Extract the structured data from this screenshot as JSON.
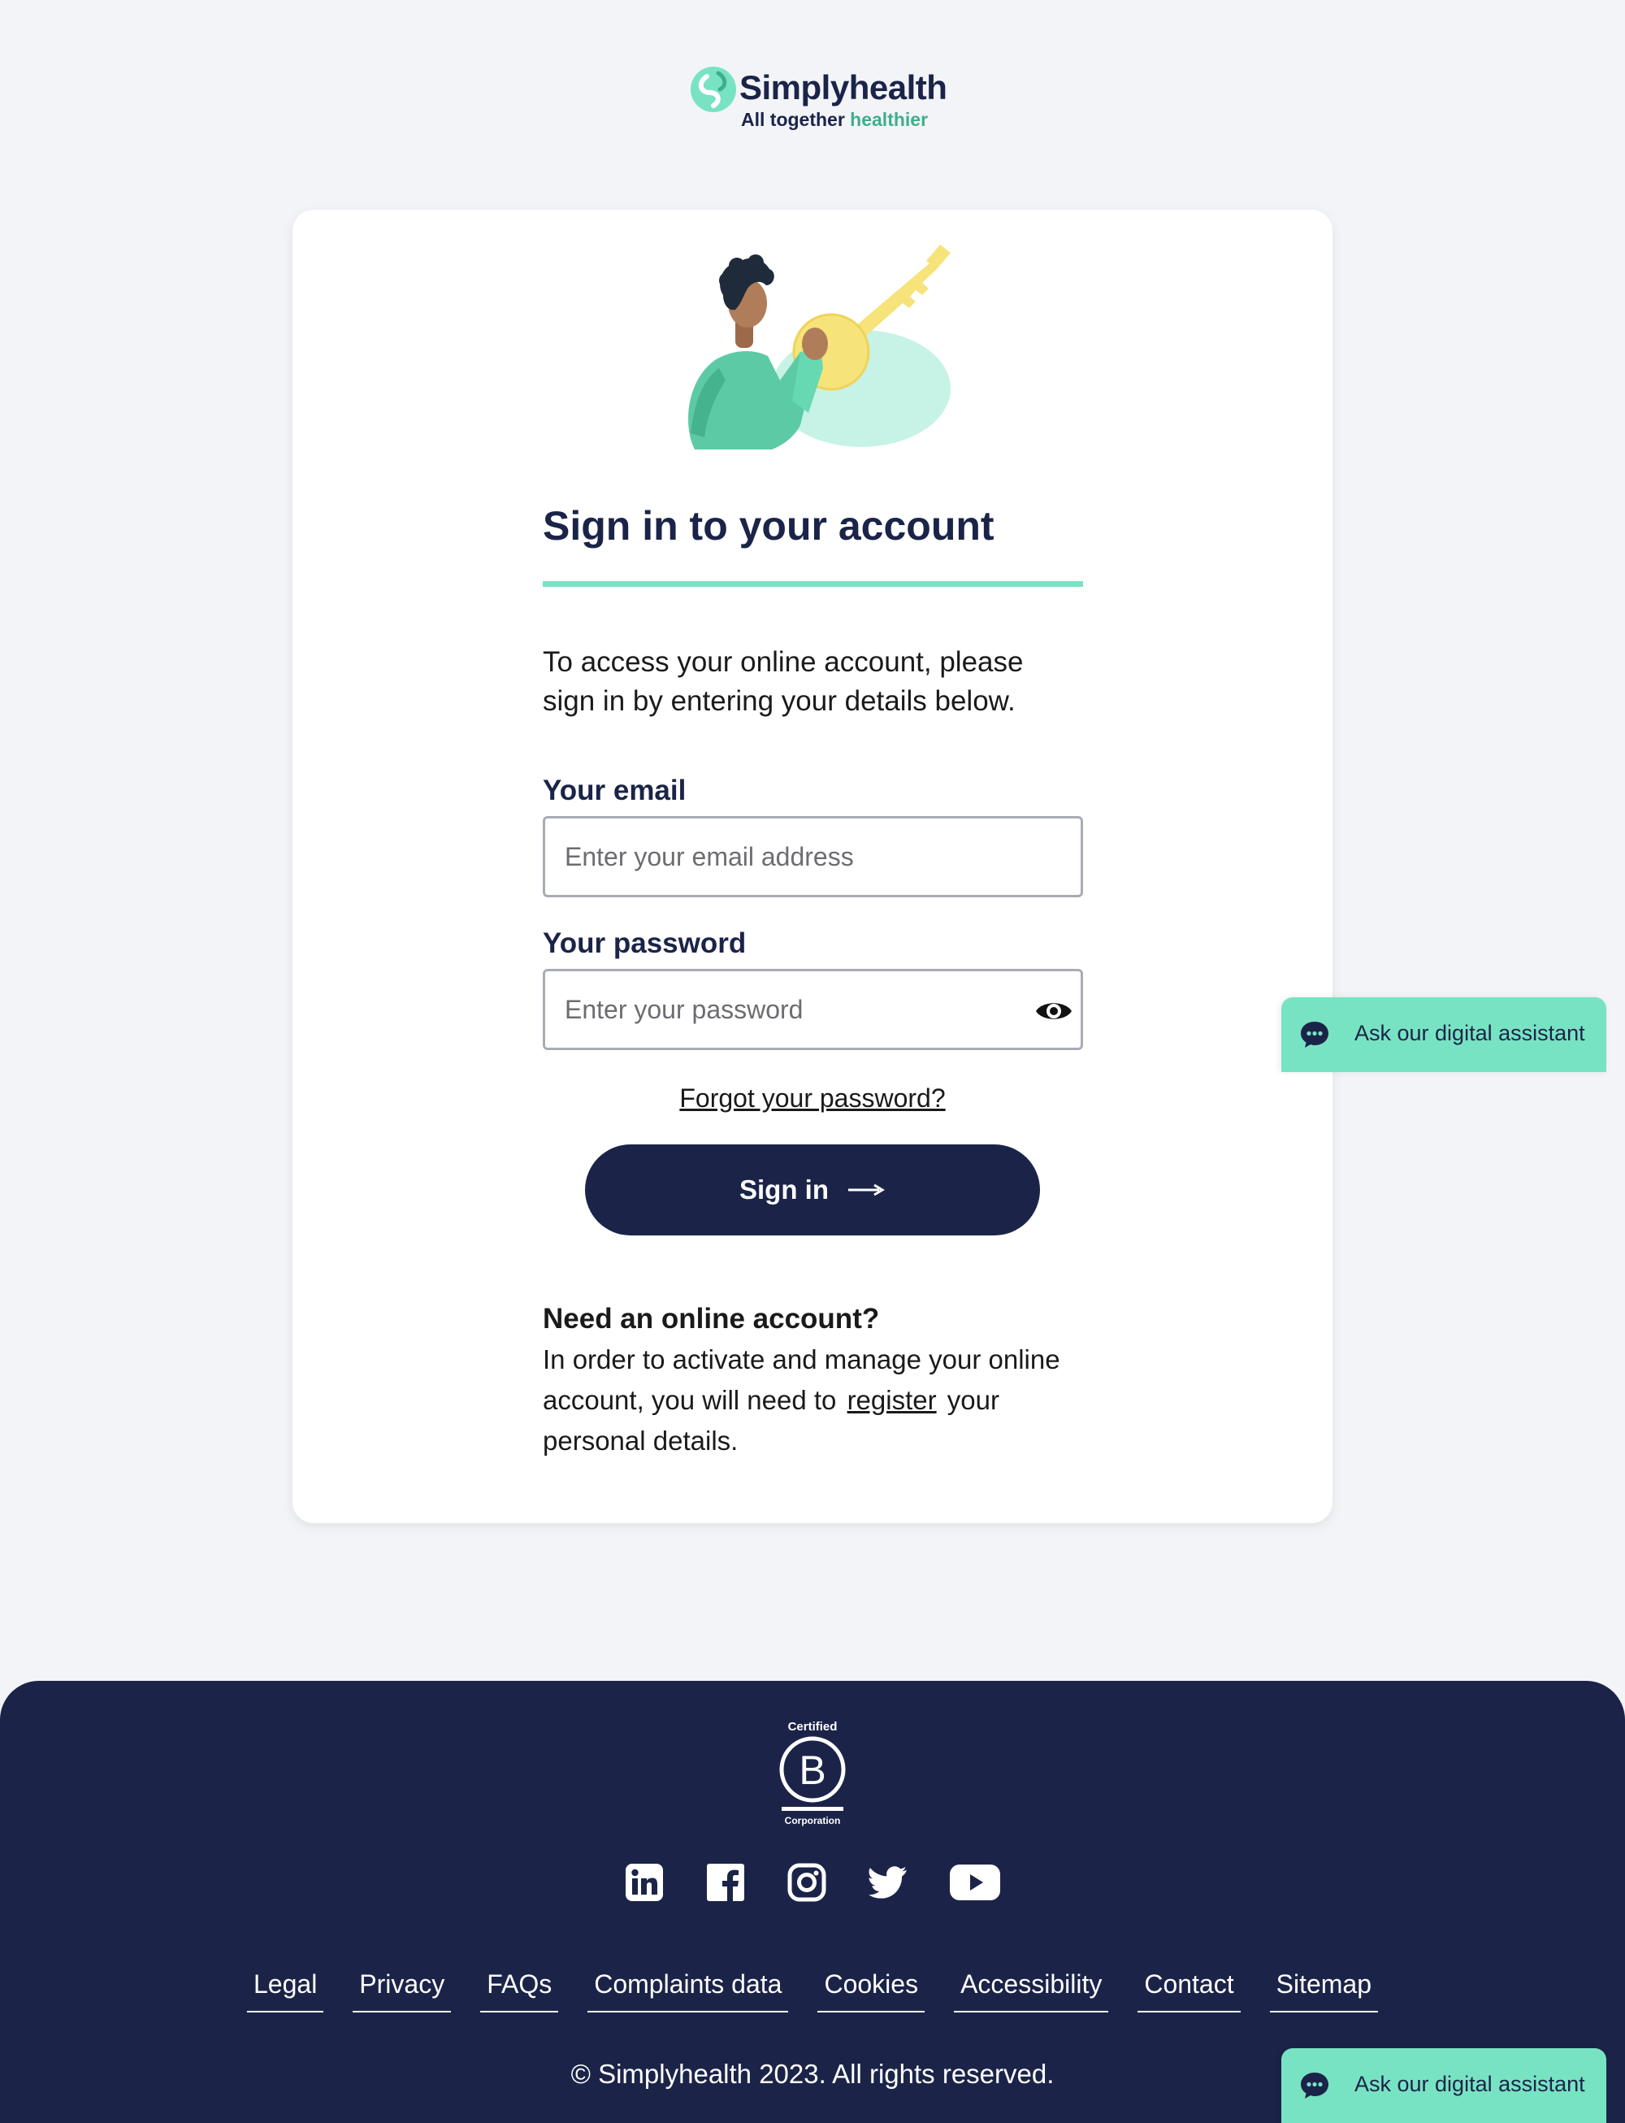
{
  "header": {
    "brand_name": "Simplyhealth",
    "tagline_main": "All together ",
    "tagline_accent": "healthier"
  },
  "signin": {
    "title": "Sign in to your account",
    "intro": "To access your online account, please sign in by entering your details below.",
    "email": {
      "label": "Your email",
      "placeholder": "Enter your email address",
      "value": ""
    },
    "password": {
      "label": "Your password",
      "placeholder": "Enter your password",
      "value": ""
    },
    "forgot_link": "Forgot your password?",
    "submit_label": "Sign in"
  },
  "register": {
    "heading": "Need an online account?",
    "text_before": "In order to activate and manage your online account, you will need to",
    "link": "register",
    "text_after": "your personal details."
  },
  "assistant": {
    "label": "Ask our digital assistant"
  },
  "footer": {
    "bcorp": {
      "top": "Certified",
      "bottom": "Corporation"
    },
    "social_icons": [
      "linkedin-icon",
      "facebook-icon",
      "instagram-icon",
      "twitter-icon",
      "youtube-icon"
    ],
    "links": [
      "Legal",
      "Privacy",
      "FAQs",
      "Complaints data",
      "Cookies",
      "Accessibility",
      "Contact",
      "Sitemap"
    ],
    "copyright": "© Simplyhealth 2023. All rights reserved."
  },
  "colors": {
    "navy": "#1b2448",
    "mint": "#78e3c3",
    "page_bg": "#f2f4f8",
    "brand_green": "#3fae8a"
  }
}
